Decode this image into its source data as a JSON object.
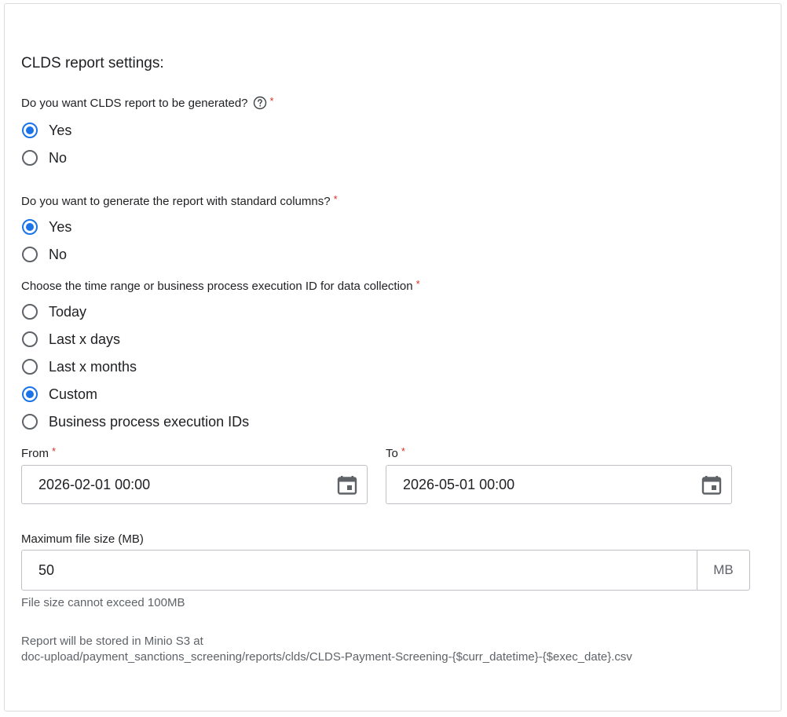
{
  "section_title": "CLDS report settings:",
  "q1": {
    "label": "Do you want CLDS report to be generated?",
    "required": "*",
    "options": [
      {
        "label": "Yes",
        "checked": true
      },
      {
        "label": "No",
        "checked": false
      }
    ]
  },
  "q2": {
    "label": "Do you want to generate the report with standard columns?",
    "required": "*",
    "options": [
      {
        "label": "Yes",
        "checked": true
      },
      {
        "label": "No",
        "checked": false
      }
    ]
  },
  "q3": {
    "label": "Choose the time range or business process execution ID for data collection",
    "required": "*",
    "options": [
      {
        "label": "Today",
        "checked": false
      },
      {
        "label": "Last x days",
        "checked": false
      },
      {
        "label": "Last x months",
        "checked": false
      },
      {
        "label": "Custom",
        "checked": true
      },
      {
        "label": "Business process execution IDs",
        "checked": false
      }
    ]
  },
  "from": {
    "label": "From",
    "required": "*",
    "value": "2026-02-01 00:00"
  },
  "to": {
    "label": "To",
    "required": "*",
    "value": "2026-05-01 00:00"
  },
  "max_size": {
    "label": "Maximum file size (MB)",
    "value": "50",
    "unit": "MB",
    "hint": "File size cannot exceed 100MB"
  },
  "storage_note": {
    "line1": "Report will be stored in Minio S3 at",
    "line2": "doc-upload/payment_sanctions_screening/reports/clds/CLDS-Payment-Screening-{$curr_datetime}-{$exec_date}.csv"
  },
  "colors": {
    "accent": "#1a73e8",
    "required": "#d93025",
    "border": "#bdc1c6"
  }
}
